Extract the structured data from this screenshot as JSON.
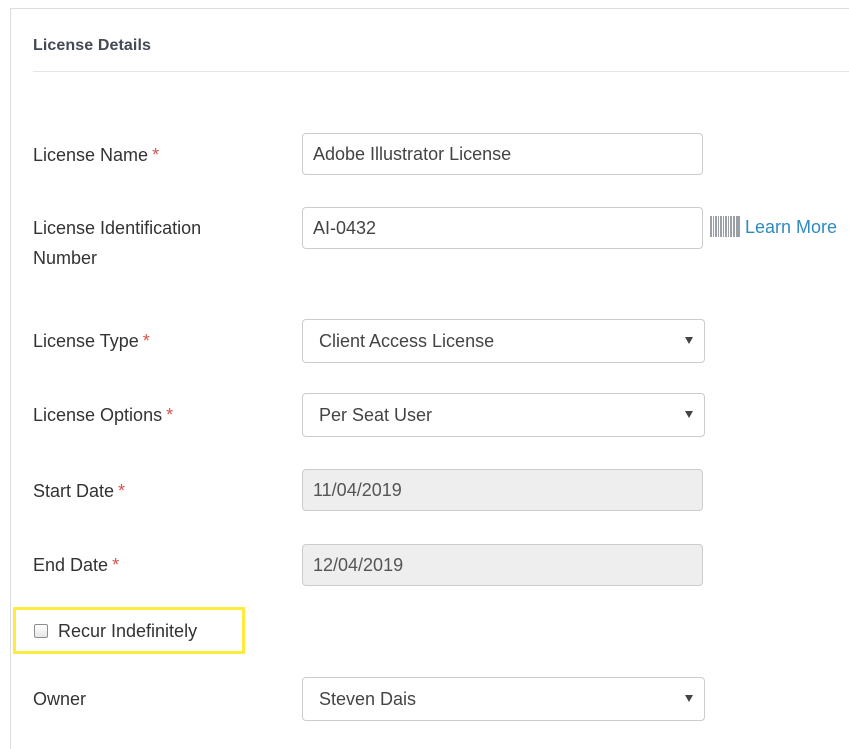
{
  "panel": {
    "title": "License Details"
  },
  "required_marker": "*",
  "form": {
    "license_name": {
      "label": "License Name",
      "value": "Adobe Illustrator License"
    },
    "license_id": {
      "label_line1": "License Identification",
      "label_line2": "Number",
      "value": "AI-0432",
      "learn_more": "Learn More"
    },
    "license_type": {
      "label": "License Type",
      "value": "Client Access License"
    },
    "license_options": {
      "label": "License Options",
      "value": "Per Seat User"
    },
    "start_date": {
      "label": "Start Date",
      "value": "11/04/2019"
    },
    "end_date": {
      "label": "End Date",
      "value": "12/04/2019"
    },
    "recur": {
      "label": "Recur Indefinitely",
      "checked": false
    },
    "owner": {
      "label": "Owner",
      "value": "Steven Dais"
    }
  },
  "colors": {
    "required": "#d9534f",
    "link": "#2e8bc0",
    "highlight": "#ffeb3b",
    "disabled_bg": "#eeeeee"
  },
  "icons": {
    "barcode": "barcode-icon",
    "dropdown": "caret-down-icon"
  }
}
